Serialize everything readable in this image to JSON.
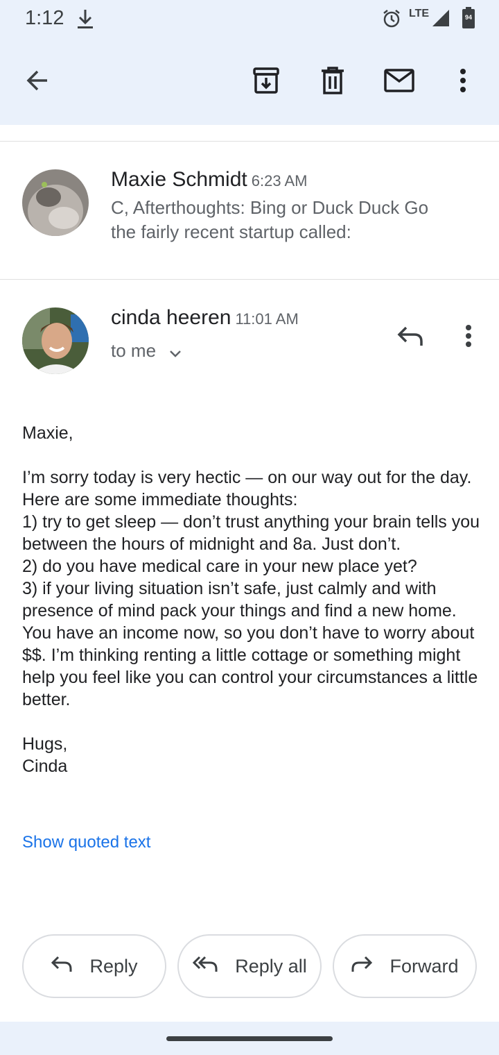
{
  "status_bar": {
    "time": "1:12",
    "network": "LTE",
    "battery_level": "94"
  },
  "toolbar": {
    "icons": [
      "back-arrow-icon",
      "archive-icon",
      "delete-icon",
      "mark-unread-icon",
      "more-vert-icon"
    ]
  },
  "previous_message": {
    "sender": "Maxie Schmidt",
    "time": "6:23 AM",
    "snippet": "C, Afterthoughts: Bing or Duck Duck Go the fairly recent startup called:"
  },
  "current_message": {
    "sender": "cinda heeren",
    "time": "11:01 AM",
    "recipient": "to me",
    "body": {
      "greeting": "Maxie,",
      "paragraph": "I’m sorry today is very hectic — on our way out for the day.  Here are some immediate thoughts:",
      "point1": "1) try to get sleep — don’t trust anything your brain tells you between the hours of midnight and 8a. Just don’t.",
      "point2": "2) do you have medical care in your new place yet?",
      "point3": "3) if your living situation isn’t safe, just calmly and with presence of mind pack your things and find a new home. You have an income now, so you don’t have to worry about $$. I’m thinking renting a little cottage or something might help you feel like you can control your circumstances a little better.",
      "signoff": "Hugs,",
      "signature": "Cinda"
    },
    "show_quoted_text": "Show quoted text"
  },
  "actions": {
    "reply": "Reply",
    "reply_all": "Reply all",
    "forward": "Forward"
  },
  "colors": {
    "header_bg": "#eaf1fb",
    "link": "#1a73e8"
  }
}
